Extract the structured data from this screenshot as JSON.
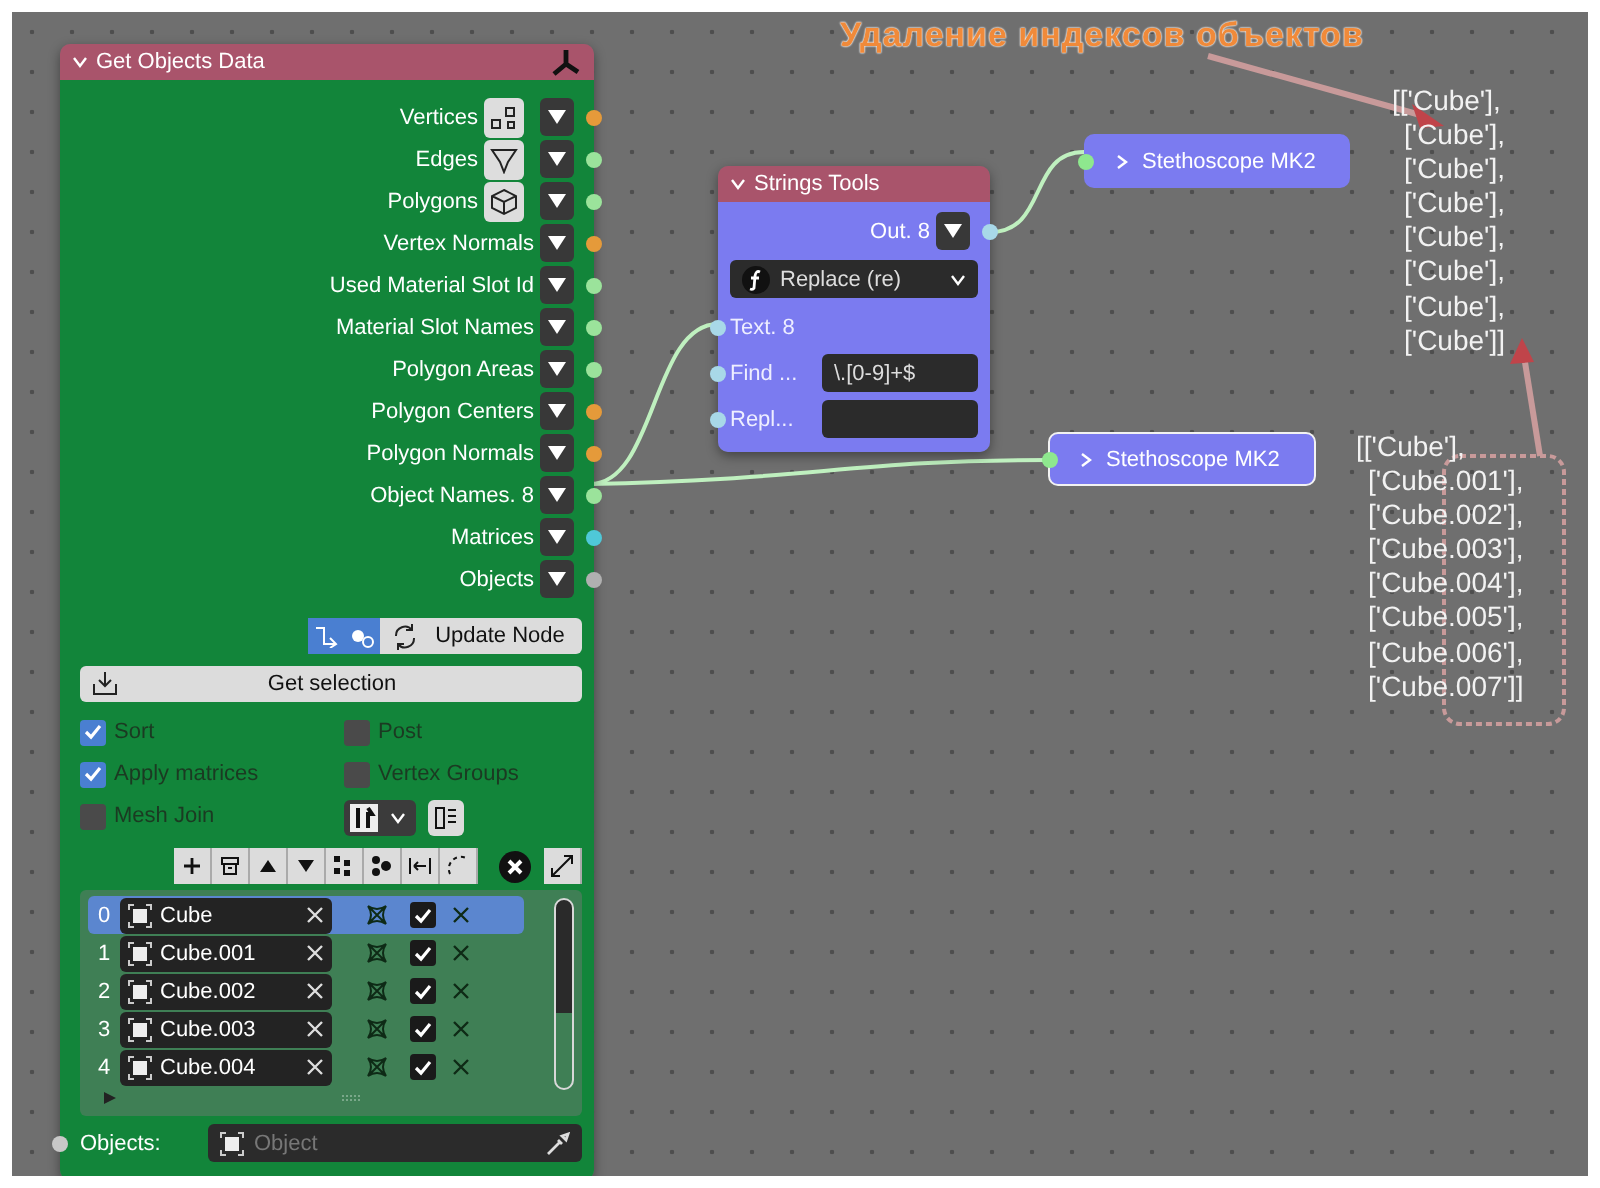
{
  "annotation": {
    "title": "Удаление индексов объектов"
  },
  "get_objects_node": {
    "title": "Get Objects Data",
    "outputs": [
      {
        "label": "Vertices",
        "kind": "with_icon",
        "color": "#e59a3a"
      },
      {
        "label": "Edges",
        "kind": "with_icon",
        "color": "#9be39b"
      },
      {
        "label": "Polygons",
        "kind": "with_icon",
        "color": "#9be39b"
      },
      {
        "label": "Vertex Normals",
        "kind": "plain",
        "color": "#e59a3a"
      },
      {
        "label": "Used Material Slot Id",
        "kind": "plain",
        "color": "#9be39b"
      },
      {
        "label": "Material Slot Names",
        "kind": "plain",
        "color": "#9be39b"
      },
      {
        "label": "Polygon Areas",
        "kind": "plain",
        "color": "#9be39b"
      },
      {
        "label": "Polygon Centers",
        "kind": "plain",
        "color": "#e59a3a"
      },
      {
        "label": "Polygon Normals",
        "kind": "plain",
        "color": "#e59a3a"
      },
      {
        "label": "Object Names. 8",
        "kind": "plain",
        "color": "#9be39b"
      },
      {
        "label": "Matrices",
        "kind": "plain",
        "color": "#4fc8d8"
      },
      {
        "label": "Objects",
        "kind": "plain",
        "color": "#b0b0b0"
      }
    ],
    "toggles": [
      {
        "on": true
      },
      {
        "on": true
      }
    ],
    "update_button": "Update Node",
    "get_selection_button": "Get selection",
    "options": [
      {
        "label": "Sort",
        "checked": true
      },
      {
        "label": "Post",
        "checked": false
      },
      {
        "label": "Apply matrices",
        "checked": true
      },
      {
        "label": "Vertex Groups",
        "checked": false
      },
      {
        "label": "Mesh Join",
        "checked": false
      }
    ],
    "list_rows": [
      {
        "index": "0",
        "name": "Cube",
        "selected": true,
        "checked": true
      },
      {
        "index": "1",
        "name": "Cube.001",
        "selected": false,
        "checked": true
      },
      {
        "index": "2",
        "name": "Cube.002",
        "selected": false,
        "checked": true
      },
      {
        "index": "3",
        "name": "Cube.003",
        "selected": false,
        "checked": true
      },
      {
        "index": "4",
        "name": "Cube.004",
        "selected": false,
        "checked": true
      }
    ],
    "objects_field": {
      "label": "Objects:",
      "placeholder": "Object"
    }
  },
  "strings_node": {
    "title": "Strings Tools",
    "output": "Out. 8",
    "mode": "Replace (re)",
    "inputs": [
      {
        "label": "Text. 8",
        "kind": "plain"
      },
      {
        "label": "Find ...",
        "kind": "field",
        "value": "\\.[0-9]+$"
      },
      {
        "label": "Repl...",
        "kind": "field"
      }
    ]
  },
  "stethoscopes": [
    {
      "title": "Stethoscope MK2",
      "selected": false,
      "output_lines": [
        "[['Cube'],",
        "['Cube'],",
        "['Cube'],",
        "['Cube'],",
        "['Cube'],",
        "['Cube'],",
        "['Cube'],",
        "['Cube']]"
      ]
    },
    {
      "title": "Stethoscope MK2",
      "selected": true,
      "output_lines": [
        "[['Cube'],",
        "['Cube.001'],",
        "['Cube.002'],",
        "['Cube.003'],",
        "['Cube.004'],",
        "['Cube.005'],",
        "['Cube.006'],",
        "['Cube.007']]"
      ]
    }
  ]
}
